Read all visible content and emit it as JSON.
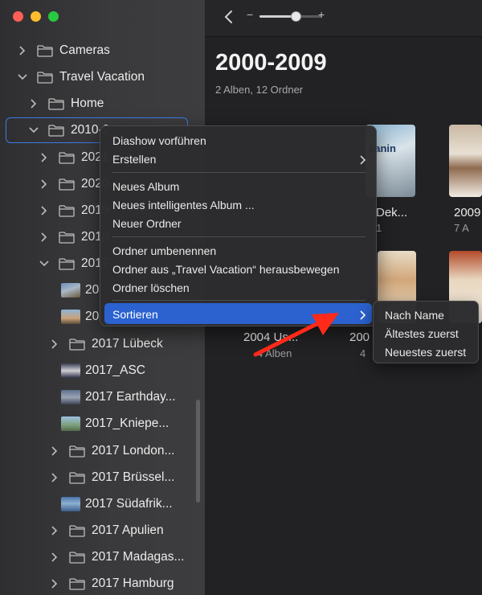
{
  "sidebar": {
    "items": [
      {
        "label": "Cameras",
        "kind": "folder",
        "expanded": false
      },
      {
        "label": "Travel Vacation",
        "kind": "folder",
        "expanded": true
      },
      {
        "label": "Home",
        "kind": "folder",
        "expanded": false
      },
      {
        "label": "2010-2",
        "kind": "folder",
        "expanded": true,
        "selected": true
      },
      {
        "label": "2021",
        "kind": "folder",
        "expanded": false
      },
      {
        "label": "2020",
        "kind": "folder",
        "expanded": false
      },
      {
        "label": "2019",
        "kind": "folder",
        "expanded": false
      },
      {
        "label": "2018",
        "kind": "folder",
        "expanded": false
      },
      {
        "label": "2017",
        "kind": "folder",
        "expanded": true
      },
      {
        "label": "20",
        "kind": "album"
      },
      {
        "label": "20",
        "kind": "album"
      },
      {
        "label": "2017 Lübeck",
        "kind": "folder",
        "expanded": false
      },
      {
        "label": "2017_ASC",
        "kind": "album"
      },
      {
        "label": "2017 Earthday...",
        "kind": "album"
      },
      {
        "label": "2017_Kniepe...",
        "kind": "album"
      },
      {
        "label": "2017 London...",
        "kind": "folder",
        "expanded": false
      },
      {
        "label": "2017 Brüssel...",
        "kind": "folder",
        "expanded": false
      },
      {
        "label": "2017 Südafrik...",
        "kind": "album"
      },
      {
        "label": "2017 Apulien",
        "kind": "folder",
        "expanded": false
      },
      {
        "label": "2017 Madagas...",
        "kind": "folder",
        "expanded": false
      },
      {
        "label": "2017 Hamburg",
        "kind": "folder",
        "expanded": false
      }
    ]
  },
  "toolbar": {
    "zoom_minus": "−",
    "zoom_plus": "+",
    "zoom_level": 0.6
  },
  "main": {
    "title": "2000-2009",
    "subtitle": "2 Alben, 12 Ordner",
    "albums": [
      {
        "name": "Dek...",
        "count": "1"
      },
      {
        "name": "2009",
        "count": "7 A"
      },
      {
        "name": "2004 Us...",
        "count": "4 Alben"
      },
      {
        "name": "200",
        "count": "4"
      }
    ]
  },
  "context_menu": {
    "items": [
      {
        "label": "Diashow vorführen"
      },
      {
        "label": "Erstellen",
        "submenu": true
      },
      {
        "label": "Neues Album"
      },
      {
        "label": "Neues intelligentes Album ..."
      },
      {
        "label": "Neuer Ordner"
      },
      {
        "label": "Ordner umbenennen"
      },
      {
        "label": "Ordner aus „Travel Vacation“ herausbewegen"
      },
      {
        "label": "Ordner löschen"
      },
      {
        "label": "Sortieren",
        "submenu": true,
        "highlighted": true
      }
    ],
    "submenu": {
      "items": [
        {
          "label": "Nach Name"
        },
        {
          "label": "Ältestes zuerst"
        },
        {
          "label": "Neuestes zuerst"
        }
      ]
    }
  },
  "colors": {
    "accent": "#2b62d0",
    "selection_outline": "#3a7be6",
    "annotation_arrow": "#ff2a1a"
  }
}
